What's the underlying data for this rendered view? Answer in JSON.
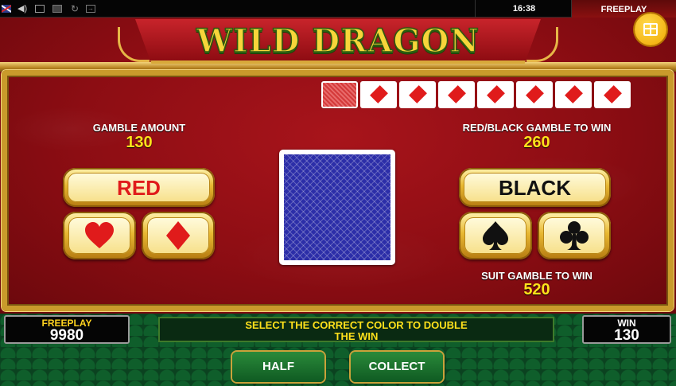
{
  "topbar": {
    "clock": "16:38",
    "mode": "FREEPLAY",
    "icons": [
      "flag-uk-icon",
      "sound-icon",
      "window-icon",
      "window-icon",
      "refresh-icon",
      "exit-icon"
    ]
  },
  "title": "WILD DRAGON",
  "history": {
    "cards": [
      "back",
      "diamond",
      "diamond",
      "diamond",
      "diamond",
      "diamond",
      "diamond",
      "diamond"
    ]
  },
  "gamble": {
    "gamble_amount_label": "GAMBLE AMOUNT",
    "gamble_amount": "130",
    "color_win_label": "RED/BLACK GAMBLE TO WIN",
    "color_win": "260",
    "suit_win_label": "SUIT GAMBLE TO WIN",
    "suit_win": "520"
  },
  "buttons": {
    "red": "RED",
    "black": "BLACK",
    "suits": [
      "heart",
      "diamond",
      "spade",
      "club"
    ],
    "half": "HALF",
    "collect": "COLLECT"
  },
  "bottom": {
    "credit_label": "FREEPLAY",
    "credit_value": "9980",
    "message_line1": "SELECT THE CORRECT COLOR TO DOUBLE",
    "message_line2": "THE WIN",
    "win_label": "WIN",
    "win_value": "130"
  },
  "colors": {
    "red_suit": "#e01b1b",
    "black_suit": "#111111",
    "gold": "#d9a93a",
    "amount_yellow": "#ffe11b",
    "card_back_blue": "#2c2ea8"
  }
}
